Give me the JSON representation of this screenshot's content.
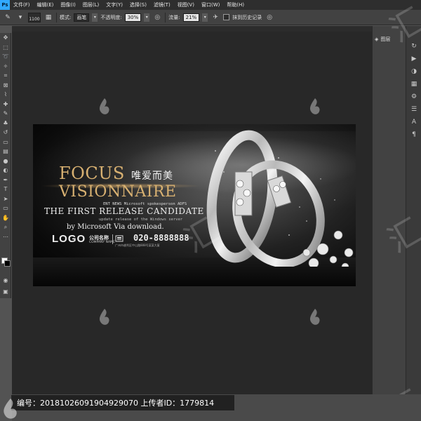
{
  "menubar": {
    "app_icon": "Ps",
    "items": [
      "文件(F)",
      "编辑(E)",
      "图像(I)",
      "图层(L)",
      "文字(Y)",
      "选择(S)",
      "滤镜(T)",
      "视图(V)",
      "窗口(W)",
      "帮助(H)"
    ]
  },
  "options": {
    "brush_size": "1100",
    "mode_label": "模式:",
    "mode_value": "画笔",
    "opacity_label": "不透明度:",
    "opacity_value": "30%",
    "flow_label": "流量:",
    "flow_value": "21%",
    "erase_history_label": "抹到历史记录"
  },
  "panel": {
    "layers_tab": "图层"
  },
  "artwork": {
    "title_line1": "FOCUS",
    "title_cn": "唯爱而美",
    "title_line2": "VISIONNAIRE",
    "sub_small": "ENT NEWS Microsoft spokesperson ADFS",
    "sub_big": "THE FIRST RELEASE CANDIDATE",
    "sub_update": "update release of the Windows server",
    "sub_by": "by Microsoft Via download.",
    "logo": "LOGO",
    "company_name": "公司名称",
    "company_en": "COMPANY NAME",
    "phone": "020-8888888",
    "address": "广州市越秀区中山路888号某某大厦"
  },
  "footer": {
    "id_text": "编号：20181026091904929070 上传者ID：1779814"
  },
  "watermark": {
    "letters": "汇"
  }
}
